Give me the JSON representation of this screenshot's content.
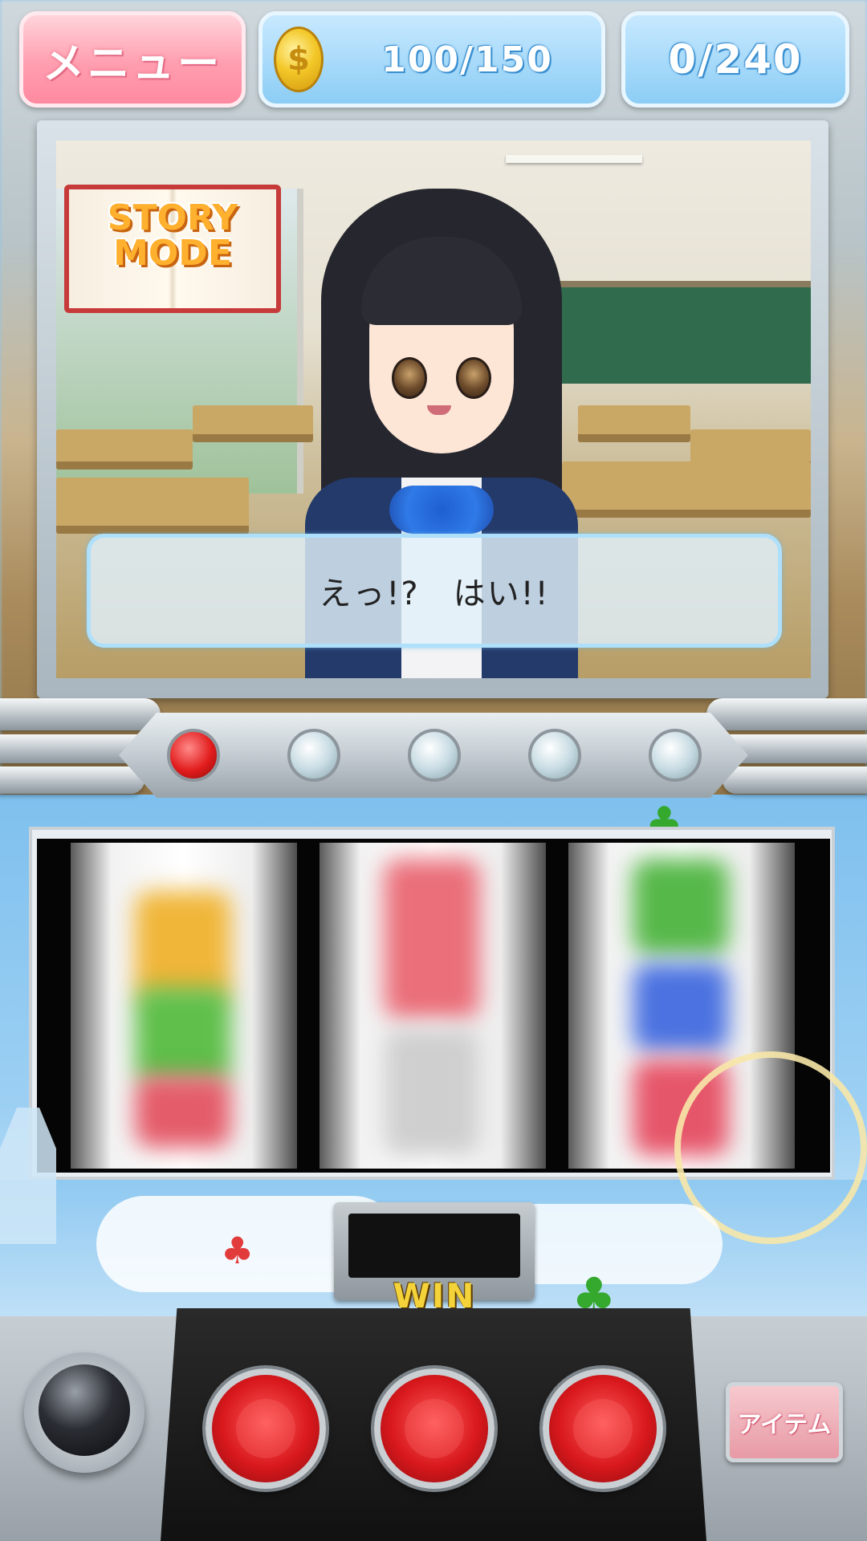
{
  "hud": {
    "menu_label": "メニュー",
    "coins": "100/150",
    "progress": "0/240",
    "coin_symbol": "$"
  },
  "story": {
    "badge_line1": "STORY",
    "badge_line2": "MODE",
    "dialogue": "えっ!?　はい!!"
  },
  "lamps": [
    {
      "state": "on",
      "color": "#e21c1c"
    },
    {
      "state": "off"
    },
    {
      "state": "off"
    },
    {
      "state": "off"
    },
    {
      "state": "off"
    }
  ],
  "reels": [
    {
      "state": "spinning"
    },
    {
      "state": "spinning"
    },
    {
      "state": "spinning"
    }
  ],
  "machine": {
    "win_label": "WIN",
    "win_value": ""
  },
  "controls": {
    "item_label": "アイテム"
  },
  "colors": {
    "menu_pink": "#ff9eaf",
    "hud_blue": "#8ccdf5",
    "stop_button_red": "#d8181c",
    "win_gold": "#f3d23a"
  },
  "icons": {
    "coin": "coin-icon",
    "clover": "clover-icon"
  }
}
